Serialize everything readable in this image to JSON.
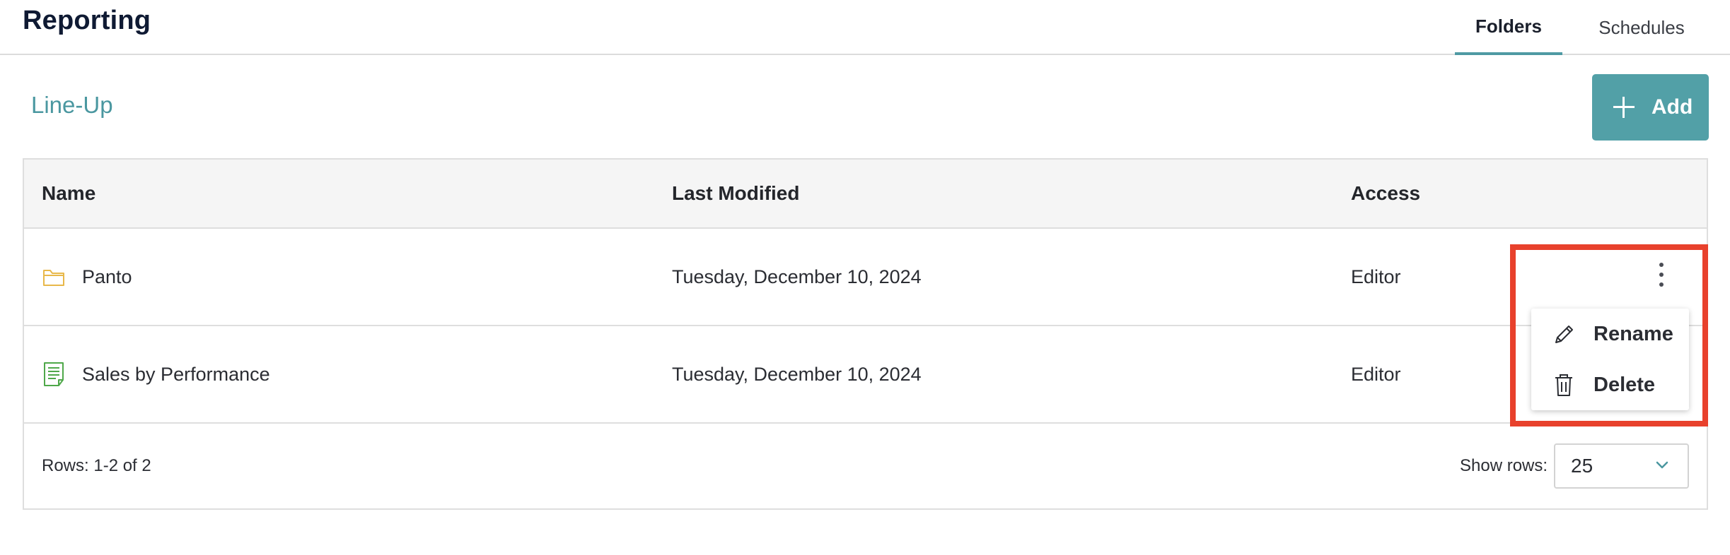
{
  "header": {
    "title": "Reporting",
    "tabs": [
      {
        "label": "Folders",
        "active": true
      },
      {
        "label": "Schedules",
        "active": false
      }
    ]
  },
  "breadcrumb": {
    "label": "Line-Up"
  },
  "toolbar": {
    "add_label": "Add"
  },
  "table": {
    "columns": [
      "Name",
      "Last Modified",
      "Access"
    ],
    "rows": [
      {
        "icon": "folder-icon",
        "name": "Panto",
        "modified": "Tuesday, December 10, 2024",
        "access": "Editor"
      },
      {
        "icon": "report-icon",
        "name": "Sales by Performance",
        "modified": "Tuesday, December 10, 2024",
        "access": "Editor"
      }
    ]
  },
  "footer": {
    "rows_info": "Rows: 1-2 of 2",
    "show_rows_label": "Show rows:",
    "show_rows_value": "25"
  },
  "context_menu": {
    "items": [
      {
        "label": "Rename",
        "icon": "pencil-icon"
      },
      {
        "label": "Delete",
        "icon": "trash-icon"
      }
    ]
  },
  "colors": {
    "accent": "#52a0a7",
    "link": "#4a97a0",
    "folder_icon": "#e8b84a",
    "report_icon": "#4fa84a",
    "highlight": "#e8412c"
  }
}
